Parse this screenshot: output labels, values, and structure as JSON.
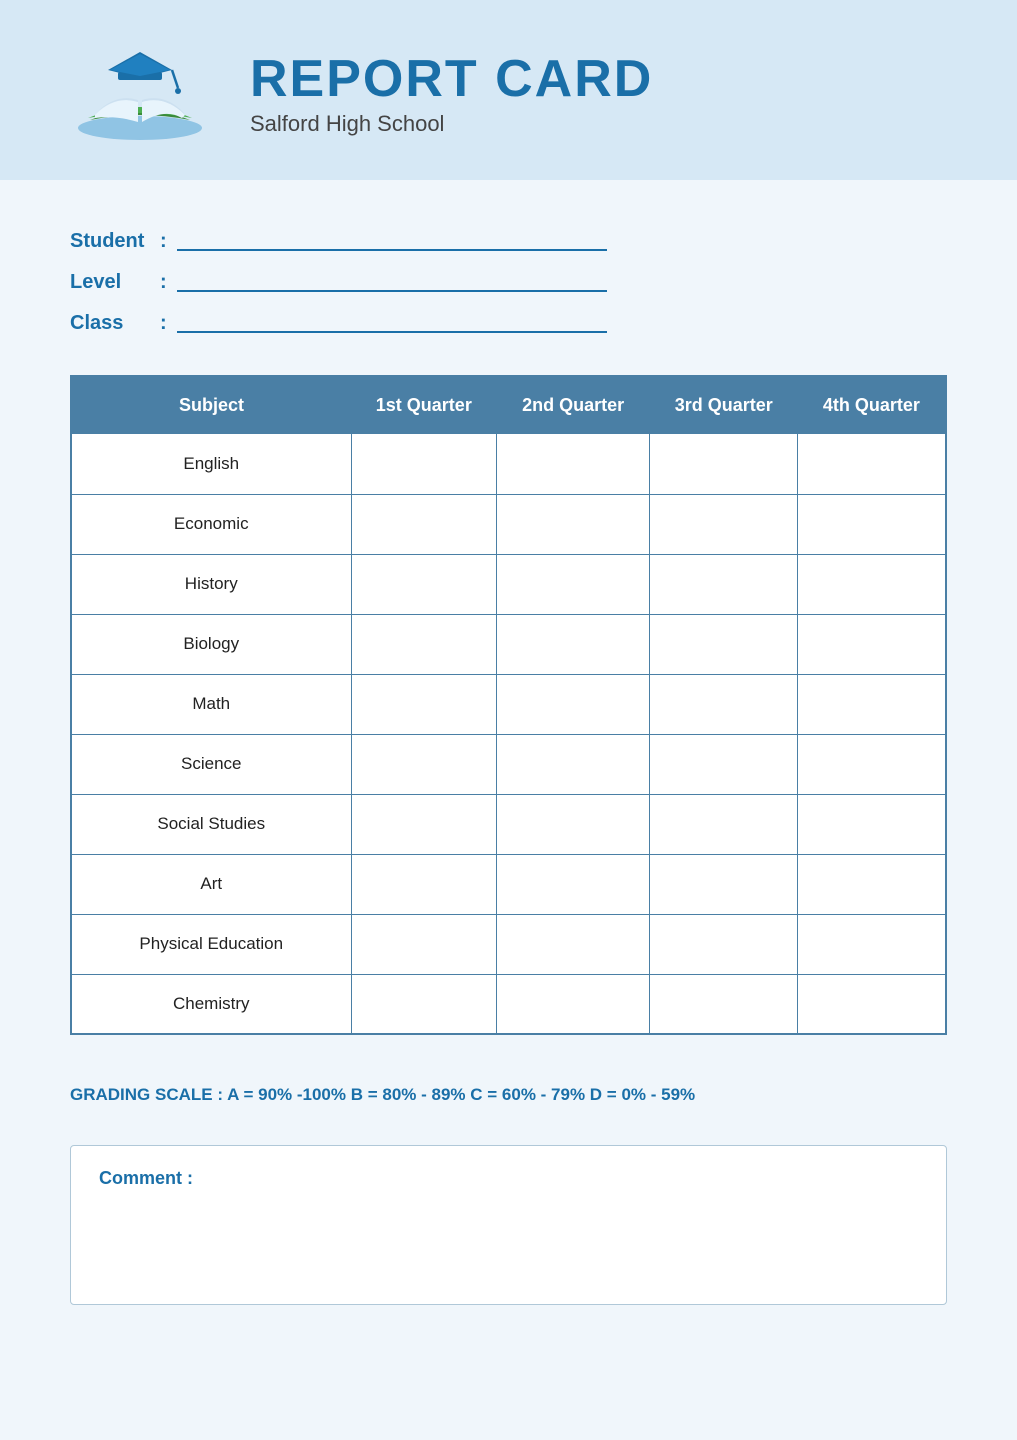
{
  "header": {
    "title": "REPORT CARD",
    "school_name": "Salford High School"
  },
  "student_info": {
    "student_label": "Student",
    "level_label": "Level",
    "class_label": "Class",
    "colon": ":"
  },
  "table": {
    "headers": [
      "Subject",
      "1st Quarter",
      "2nd Quarter",
      "3rd Quarter",
      "4th Quarter"
    ],
    "rows": [
      {
        "subject": "English"
      },
      {
        "subject": "Economic"
      },
      {
        "subject": "History"
      },
      {
        "subject": "Biology"
      },
      {
        "subject": "Math"
      },
      {
        "subject": "Science"
      },
      {
        "subject": "Social Studies"
      },
      {
        "subject": "Art"
      },
      {
        "subject": "Physical Education"
      },
      {
        "subject": "Chemistry"
      }
    ]
  },
  "grading_scale": {
    "label": "GRADING SCALE :",
    "values": "A = 90% -100%  B = 80% - 89%  C = 60% - 79%  D = 0% - 59%"
  },
  "comment": {
    "label": "Comment :"
  }
}
